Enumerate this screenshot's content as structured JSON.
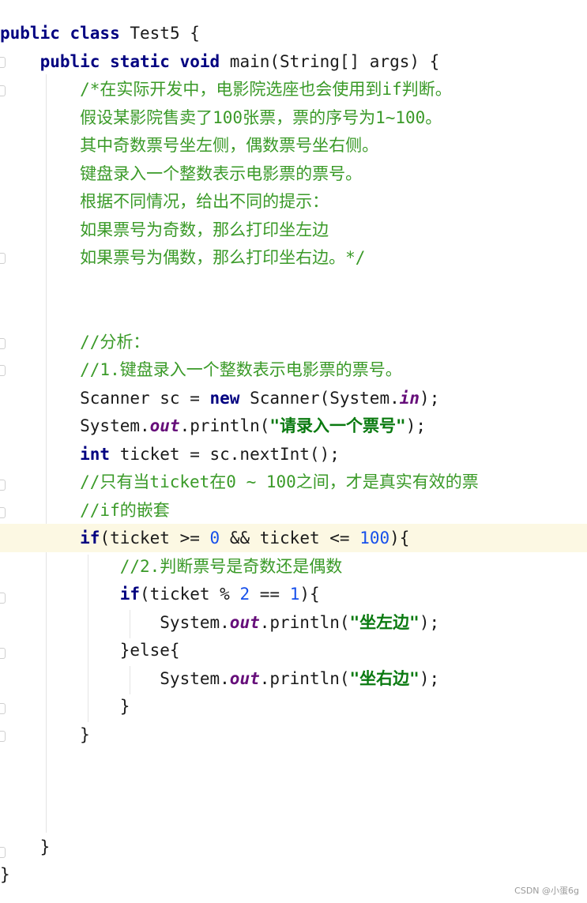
{
  "code_lines": [
    [
      {
        "t": "public class ",
        "c": "kw"
      },
      {
        "t": "Test5 {",
        "c": "pl"
      }
    ],
    [
      {
        "t": "    public static void ",
        "c": "kw"
      },
      {
        "t": "main(String[] args) {",
        "c": "pl"
      }
    ],
    [
      {
        "t": "        /*在实际开发中，电影院选座也会使用到if判断。",
        "c": "cm"
      }
    ],
    [
      {
        "t": "        假设某影院售卖了100张票，票的序号为1~100。",
        "c": "cm"
      }
    ],
    [
      {
        "t": "        其中奇数票号坐左侧，偶数票号坐右侧。",
        "c": "cm"
      }
    ],
    [
      {
        "t": "        键盘录入一个整数表示电影票的票号。",
        "c": "cm"
      }
    ],
    [
      {
        "t": "        根据不同情况，给出不同的提示：",
        "c": "cm"
      }
    ],
    [
      {
        "t": "        如果票号为奇数，那么打印坐左边",
        "c": "cm"
      }
    ],
    [
      {
        "t": "        如果票号为偶数，那么打印坐右边。*/",
        "c": "cm"
      }
    ],
    [],
    [],
    [
      {
        "t": "        //分析：",
        "c": "cm"
      }
    ],
    [
      {
        "t": "        //1.键盘录入一个整数表示电影票的票号。",
        "c": "cm"
      }
    ],
    [
      {
        "t": "        Scanner sc = ",
        "c": "pl"
      },
      {
        "t": "new ",
        "c": "kw"
      },
      {
        "t": "Scanner(System.",
        "c": "pl"
      },
      {
        "t": "in",
        "c": "fld"
      },
      {
        "t": ");",
        "c": "pl"
      }
    ],
    [
      {
        "t": "        System.",
        "c": "pl"
      },
      {
        "t": "out",
        "c": "fld"
      },
      {
        "t": ".println(",
        "c": "pl"
      },
      {
        "t": "\"请录入一个票号\"",
        "c": "str"
      },
      {
        "t": ");",
        "c": "pl"
      }
    ],
    [
      {
        "t": "        int ",
        "c": "kw"
      },
      {
        "t": "ticket = sc.nextInt();",
        "c": "pl"
      }
    ],
    [
      {
        "t": "        //只有当ticket在0 ~ 100之间，才是真实有效的票",
        "c": "cm"
      }
    ],
    [
      {
        "t": "        //if的嵌套",
        "c": "cm"
      }
    ],
    [
      {
        "t": "        if",
        "c": "kw"
      },
      {
        "t": "(ticket >= ",
        "c": "pl"
      },
      {
        "t": "0",
        "c": "num"
      },
      {
        "t": " && ticket <= ",
        "c": "pl"
      },
      {
        "t": "100",
        "c": "num"
      },
      {
        "t": "){",
        "c": "pl"
      }
    ],
    [
      {
        "t": "            //2.判断票号是奇数还是偶数",
        "c": "cm"
      }
    ],
    [
      {
        "t": "            if",
        "c": "kw"
      },
      {
        "t": "(ticket % ",
        "c": "pl"
      },
      {
        "t": "2",
        "c": "num"
      },
      {
        "t": " == ",
        "c": "pl"
      },
      {
        "t": "1",
        "c": "num"
      },
      {
        "t": "){",
        "c": "pl"
      }
    ],
    [
      {
        "t": "                System.",
        "c": "pl"
      },
      {
        "t": "out",
        "c": "fld"
      },
      {
        "t": ".println(",
        "c": "pl"
      },
      {
        "t": "\"坐左边\"",
        "c": "str"
      },
      {
        "t": ");",
        "c": "pl"
      }
    ],
    [
      {
        "t": "            }else{",
        "c": "pl"
      }
    ],
    [
      {
        "t": "                System.",
        "c": "pl"
      },
      {
        "t": "out",
        "c": "fld"
      },
      {
        "t": ".println(",
        "c": "pl"
      },
      {
        "t": "\"坐右边\"",
        "c": "str"
      },
      {
        "t": ");",
        "c": "pl"
      }
    ],
    [
      {
        "t": "            }",
        "c": "pl"
      }
    ],
    [
      {
        "t": "        }",
        "c": "pl"
      }
    ],
    [],
    [],
    [],
    [
      {
        "t": "    }",
        "c": "pl"
      }
    ],
    [
      {
        "t": "}",
        "c": "pl"
      }
    ]
  ],
  "highlighted_line": 18,
  "watermark": "CSDN @小蛋6g"
}
